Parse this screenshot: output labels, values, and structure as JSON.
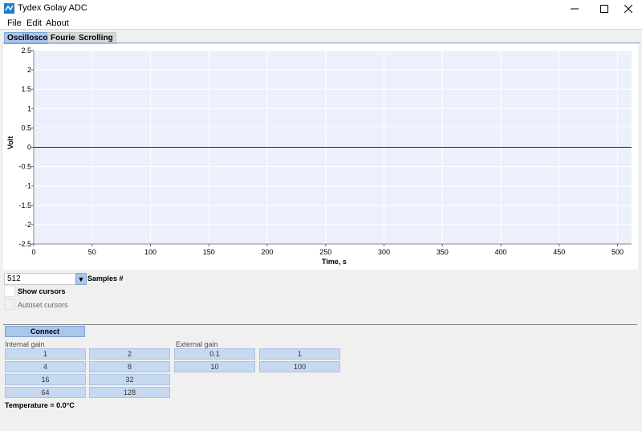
{
  "window": {
    "title": "Tydex Golay ADC"
  },
  "menu": {
    "items": [
      "File",
      "Edit",
      "About"
    ]
  },
  "tabs": [
    {
      "label": "Oscilloscope",
      "active": true
    },
    {
      "label": "Fourier",
      "active": false
    },
    {
      "label": "Scrolling",
      "active": false
    }
  ],
  "colors": {
    "accent": "#aac6ea",
    "plot_bg": "#ecf0fd",
    "signal": "#1a1a8c",
    "gain_button": "#c6d9f1"
  },
  "chart_data": {
    "type": "line",
    "xlabel": "Time, s",
    "ylabel": "Volt",
    "xlim": [
      0,
      512
    ],
    "ylim": [
      -2.5,
      2.5
    ],
    "xticks": [
      0,
      50,
      100,
      150,
      200,
      250,
      300,
      350,
      400,
      450,
      500
    ],
    "yticks": [
      2.5,
      2,
      1.5,
      1,
      0.5,
      0,
      -0.5,
      -1,
      -1.5,
      -2,
      -2.5
    ],
    "grid": true,
    "series": [
      {
        "x": [
          0,
          512
        ],
        "y": [
          0,
          0
        ]
      }
    ]
  },
  "samples": {
    "value": "512",
    "label": "Samples #"
  },
  "cursors": {
    "show_label": "Show cursors",
    "autoset_label": "Autoset cursors"
  },
  "connect_label": "Connect",
  "internal_gain": {
    "label": "Internal gain",
    "values": [
      "1",
      "2",
      "4",
      "8",
      "16",
      "32",
      "64",
      "128"
    ]
  },
  "external_gain": {
    "label": "External gain",
    "values": [
      "0.1",
      "1",
      "10",
      "100"
    ]
  },
  "temperature": "Temperature = 0.0°C"
}
